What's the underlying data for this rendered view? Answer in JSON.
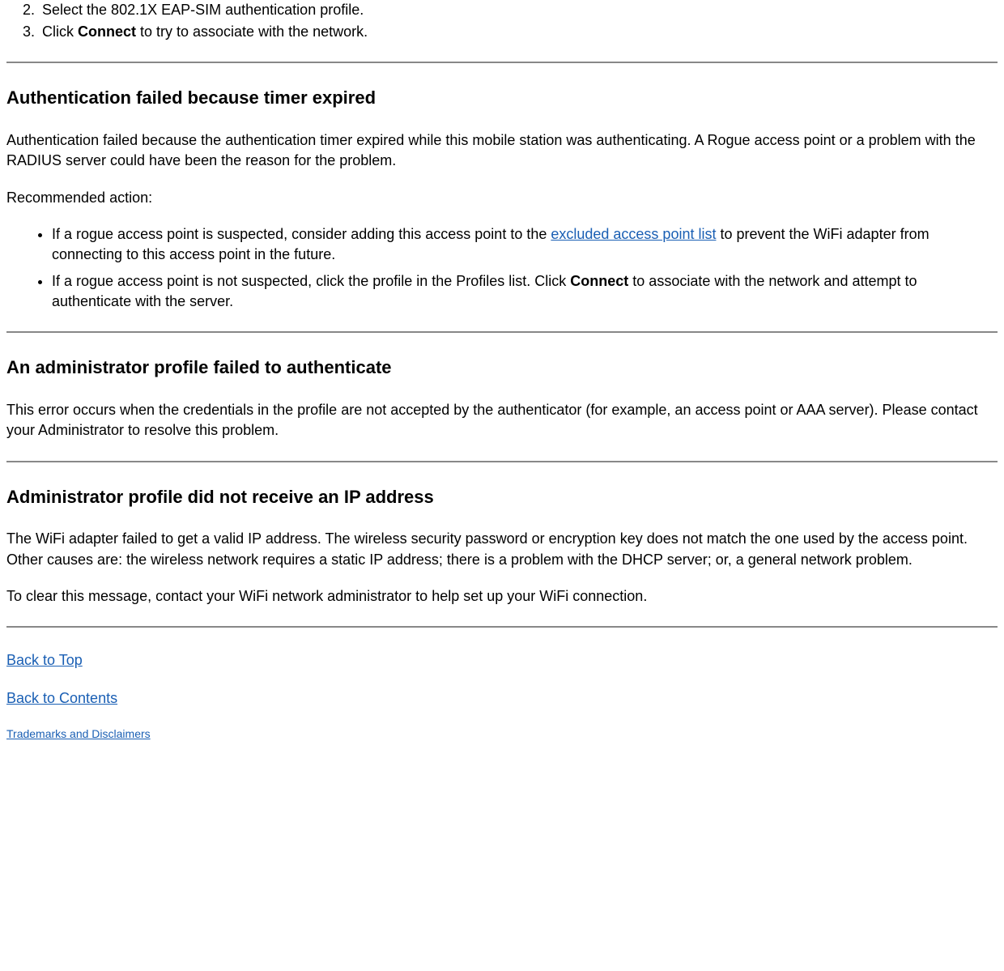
{
  "ordered_list": {
    "start": 2,
    "items": [
      {
        "text": "Select the 802.1X EAP-SIM authentication profile."
      },
      {
        "prefix": "Click ",
        "bold": "Connect",
        "suffix": " to try to associate with the network."
      }
    ]
  },
  "section1": {
    "heading": "Authentication failed because timer expired",
    "para1": "Authentication failed because the authentication timer expired while this mobile station was authenticating. A Rogue access point or a problem with the RADIUS server could have been the reason for the problem.",
    "para2": "Recommended action:",
    "bullets": [
      {
        "prefix": "If a rogue access point is suspected, consider adding this access point to the ",
        "link": "excluded access point list",
        "suffix": " to prevent the WiFi adapter from connecting to this access point in the future."
      },
      {
        "prefix": "If a rogue access point is not suspected, click the profile in the Profiles list. Click ",
        "bold": "Connect",
        "suffix": " to associate with the network and attempt to authenticate with the server."
      }
    ]
  },
  "section2": {
    "heading": "An administrator profile failed to authenticate",
    "para1": "This error occurs when the credentials in the profile are not accepted by the authenticator (for example, an access point or AAA server). Please contact your Administrator to resolve this problem."
  },
  "section3": {
    "heading": "Administrator profile did not receive an IP address",
    "para1": "The WiFi adapter failed to get a valid IP address. The wireless security password or encryption key does not match the one used by the access point. Other causes are: the wireless network requires a static IP address; there is a problem with the DHCP server; or, a general network problem.",
    "para2": "To clear this message, contact your WiFi network administrator to help set up your WiFi connection."
  },
  "nav": {
    "back_to_top": "Back to Top",
    "back_to_contents": "Back to Contents",
    "trademarks": "Trademarks and Disclaimers"
  }
}
